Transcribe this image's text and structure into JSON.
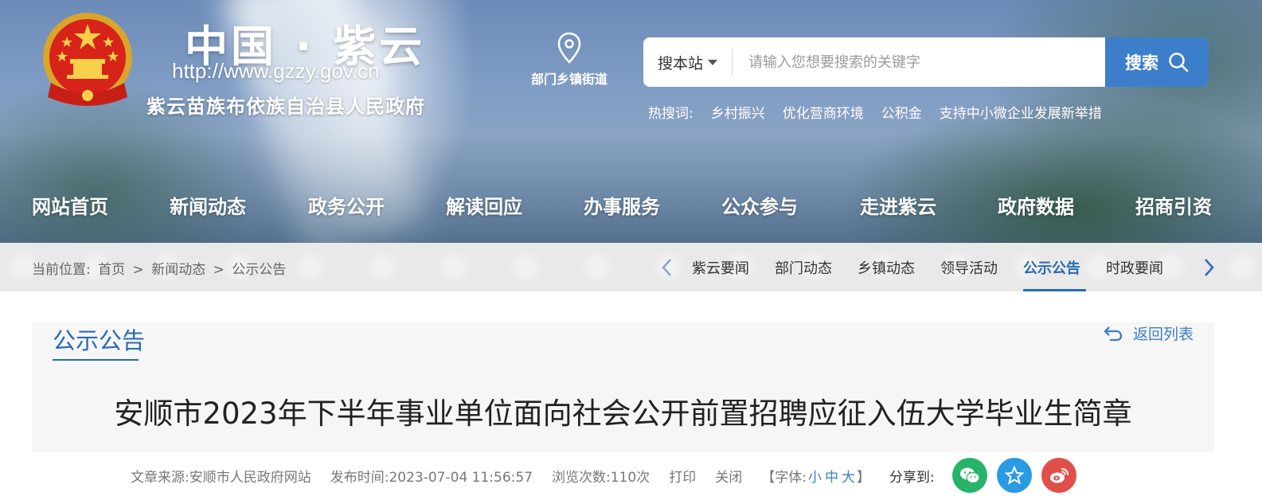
{
  "header": {
    "site_title": "中国 · 紫云",
    "site_url": "http://www.gzzy.gov.cn",
    "site_subtitle": "紫云苗族布依族自治县人民政府",
    "location_label": "部门乡镇街道",
    "search": {
      "scope": "搜本站",
      "placeholder": "请输入您想要搜索的关键字",
      "button_label": "搜索"
    },
    "hot_search": {
      "label": "热搜词:",
      "items": [
        "乡村振兴",
        "优化营商环境",
        "公积金",
        "支持中小微企业发展新举措"
      ]
    }
  },
  "nav": {
    "items": [
      "网站首页",
      "新闻动态",
      "政务公开",
      "解读回应",
      "办事服务",
      "公众参与",
      "走进紫云",
      "政府数据",
      "招商引资"
    ]
  },
  "breadcrumb": {
    "label": "当前位置:",
    "items": [
      "首页",
      ">",
      "新闻动态",
      ">",
      "公示公告"
    ]
  },
  "subnav": {
    "items": [
      "紫云要闻",
      "部门动态",
      "乡镇动态",
      "领导活动",
      "公示公告",
      "时政要闻"
    ],
    "active": "公示公告"
  },
  "content": {
    "section_title": "公示公告",
    "back_label": "返回列表",
    "article_title": "安顺市2023年下半年事业单位面向社会公开前置招聘应征入伍大学毕业生简章",
    "meta": {
      "source": "文章来源:安顺市人民政府网站",
      "publish_time": "发布时间:2023-07-04 11:56:57",
      "views": "浏览次数:110次",
      "print": "打印",
      "close": "关闭",
      "font_prefix": "【字体:",
      "font_small": "小",
      "font_medium": "中",
      "font_large": "大",
      "font_suffix": "】",
      "share_label": "分享到:"
    }
  },
  "colors": {
    "accent": "#2a6bb3",
    "search_button": "#3c7ec9",
    "wechat": "#27b36a",
    "qzone": "#2a9ae5",
    "weibo": "#e0504b"
  },
  "icons": {
    "location": "map-pin-icon",
    "search": "search-icon",
    "back": "return-arrow-icon",
    "share": [
      "wechat-icon",
      "qzone-star-icon",
      "weibo-icon"
    ]
  }
}
